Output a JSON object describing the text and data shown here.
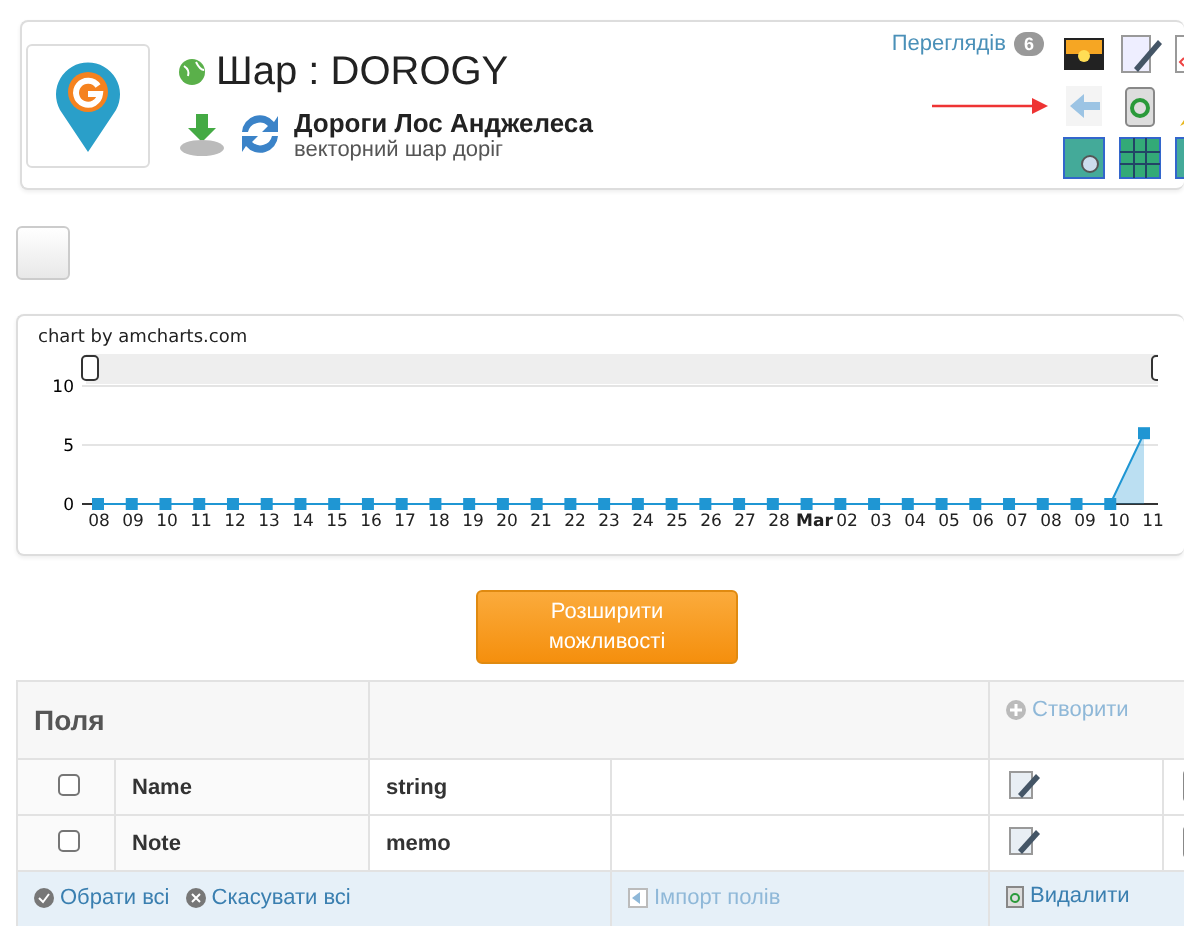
{
  "header": {
    "title": "Шар : DOROGY",
    "views_label": "Переглядів",
    "views_count": "6",
    "layer_name": "Дороги Лос Анджелеса",
    "layer_description": "векторний шар доріг"
  },
  "chart": {
    "credit": "chart by amcharts.com",
    "chart_data": {
      "type": "area",
      "categories": [
        "08",
        "09",
        "10",
        "11",
        "12",
        "13",
        "14",
        "15",
        "16",
        "17",
        "18",
        "19",
        "20",
        "21",
        "22",
        "23",
        "24",
        "25",
        "26",
        "27",
        "28",
        "**Mar**",
        "02",
        "03",
        "04",
        "05",
        "06",
        "07",
        "08",
        "09",
        "10",
        "11"
      ],
      "series": [
        {
          "color": "#1f96d3",
          "values": [
            0,
            0,
            0,
            0,
            0,
            0,
            0,
            0,
            0,
            0,
            0,
            0,
            0,
            0,
            0,
            0,
            0,
            0,
            0,
            0,
            0,
            0,
            0,
            0,
            0,
            0,
            0,
            0,
            0,
            0,
            0,
            6
          ]
        }
      ],
      "ylim": [
        0,
        10
      ],
      "yticks": [
        0,
        5,
        10
      ]
    }
  },
  "upgrade_button": "Розширити можливості",
  "fields": {
    "title": "Поля",
    "create": "Створити",
    "rows": [
      {
        "name": "Name",
        "type": "string",
        "checked": false
      },
      {
        "name": "Note",
        "type": "memo",
        "checked": false
      }
    ],
    "footer": {
      "select_all": "Обрати всі",
      "cancel_all": "Скасувати всі",
      "import": "Імпорт полів",
      "delete": "Видалити"
    }
  }
}
